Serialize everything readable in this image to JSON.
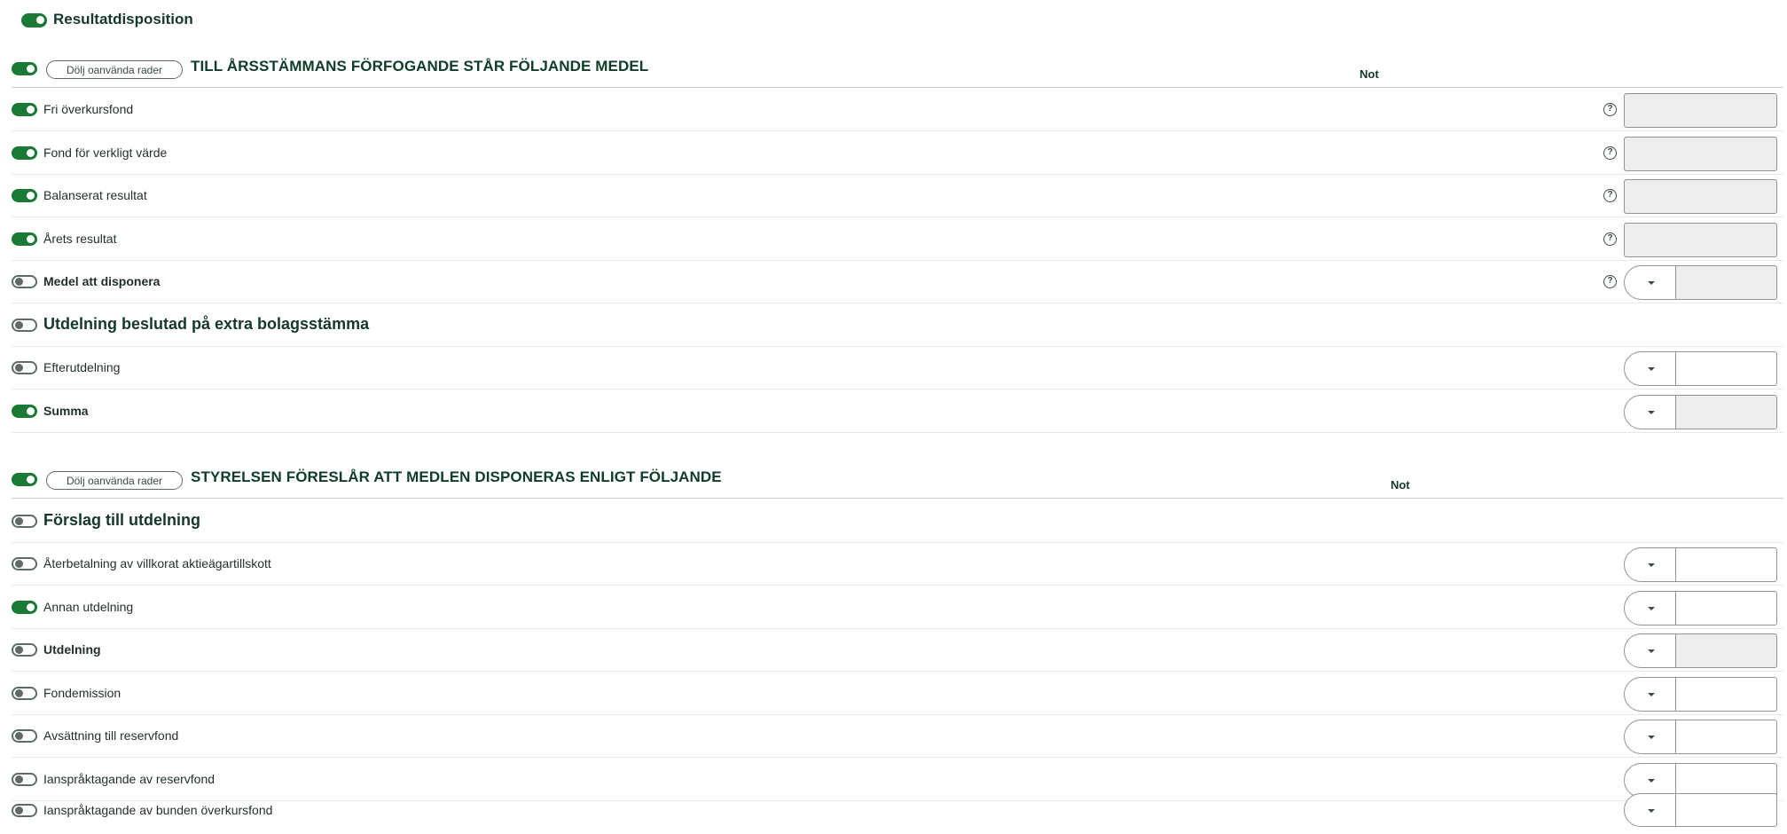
{
  "main": {
    "title": "Resultatdisposition",
    "toggle_on": true
  },
  "section1": {
    "title": "TILL ÅRSSTÄMMANS FÖRFOGANDE STÅR FÖLJANDE MEDEL",
    "hide_button_label": "Dölj oanvända rader",
    "not_label": "Not",
    "rows": [
      {
        "label": "Fri överkursfond",
        "on": true
      },
      {
        "label": "Fond för verkligt värde",
        "on": true
      },
      {
        "label": "Balanserat resultat",
        "on": true
      },
      {
        "label": "Årets resultat",
        "on": true
      },
      {
        "label": "Medel att disponera",
        "on": false
      },
      {
        "label": "Utdelning beslutad på extra bolagsstämma",
        "on": false
      },
      {
        "label": "Efterutdelning",
        "on": false
      },
      {
        "label": "Summa",
        "on": true
      }
    ]
  },
  "section2": {
    "title": "STYRELSEN FÖRESLÅR ATT MEDLEN DISPONERAS ENLIGT FÖLJANDE",
    "hide_button_label": "Dölj oanvända rader",
    "not_label": "Not",
    "rows": [
      {
        "label": "Förslag till utdelning",
        "on": false
      },
      {
        "label": "Återbetalning av villkorat aktieägartillskott",
        "on": false
      },
      {
        "label": "Annan utdelning",
        "on": true
      },
      {
        "label": "Utdelning",
        "on": false
      },
      {
        "label": "Fondemission",
        "on": false
      },
      {
        "label": "Avsättning till reservfond",
        "on": false
      },
      {
        "label": "Ianspråktagande av reservfond",
        "on": false
      },
      {
        "label": "Ianspråktagande av bunden överkursfond",
        "on": false
      }
    ]
  },
  "icons": {
    "help": "?"
  },
  "colors": {
    "accent": "#1a7a35",
    "text": "#16382a",
    "input_disabled": "#eeeeee"
  }
}
